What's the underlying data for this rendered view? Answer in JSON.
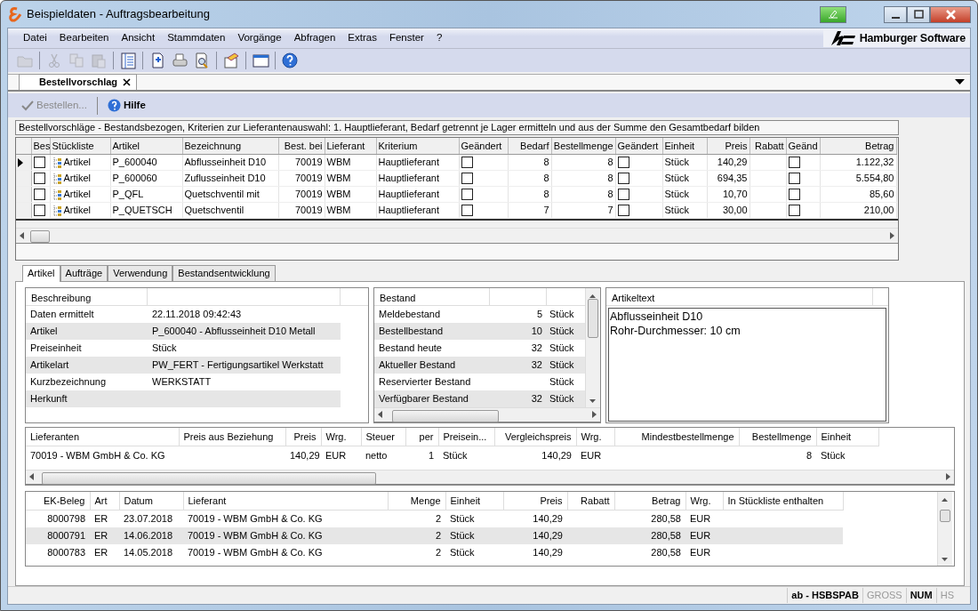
{
  "window": {
    "title": "Beispieldaten - Auftragsbearbeitung"
  },
  "menu": [
    "Datei",
    "Bearbeiten",
    "Ansicht",
    "Stammdaten",
    "Vorgänge",
    "Abfragen",
    "Extras",
    "Fenster",
    "?"
  ],
  "logo": {
    "text": "Hamburger Software"
  },
  "toolbar": [
    {
      "kind": "folder",
      "disabled": true
    },
    {
      "kind": "sep"
    },
    {
      "kind": "cut",
      "disabled": true
    },
    {
      "kind": "copy",
      "disabled": true
    },
    {
      "kind": "paste",
      "disabled": true
    },
    {
      "kind": "sep"
    },
    {
      "kind": "list",
      "disabled": false
    },
    {
      "kind": "sep"
    },
    {
      "kind": "new",
      "disabled": false
    },
    {
      "kind": "print",
      "disabled": false
    },
    {
      "kind": "preview",
      "disabled": false
    },
    {
      "kind": "sep"
    },
    {
      "kind": "settings",
      "disabled": false
    },
    {
      "kind": "sep"
    },
    {
      "kind": "window",
      "disabled": false
    },
    {
      "kind": "sep"
    },
    {
      "kind": "help",
      "disabled": false
    }
  ],
  "doc_tabs": [
    {
      "label": "Bestellvorschlag",
      "selected": true
    }
  ],
  "actions": [
    {
      "kind": "check",
      "label": "Bestellen...",
      "disabled": true
    },
    {
      "kind": "help",
      "label": "Hilfe",
      "disabled": false
    }
  ],
  "info_line": "Bestellvorschläge - Bestandsbezogen, Kriterien zur Lieferantenauswahl: 1. Hauptlieferant, Bedarf getrennt je Lager ermitteln und aus der Summe den Gesamtbedarf bilden",
  "order_grid": {
    "columns": [
      {
        "label": "Bes",
        "kind": "check"
      },
      {
        "label": "Stückliste",
        "kind": "bom"
      },
      {
        "label": "Artikel",
        "kind": "text"
      },
      {
        "label": "Bezeichnung",
        "kind": "text"
      },
      {
        "label": "Best. bei",
        "kind": "num"
      },
      {
        "label": "Lieferant",
        "kind": "text"
      },
      {
        "label": "Kriterium",
        "kind": "text"
      },
      {
        "label": "Geändert",
        "kind": "check"
      },
      {
        "label": "Bedarf",
        "kind": "num"
      },
      {
        "label": "Bestellmenge",
        "kind": "num"
      },
      {
        "label": "Geändert",
        "kind": "check"
      },
      {
        "label": "Einheit",
        "kind": "text"
      },
      {
        "label": "Preis",
        "kind": "num"
      },
      {
        "label": "Rabatt",
        "kind": "num"
      },
      {
        "label": "Geänd",
        "kind": "check"
      },
      {
        "label": "Betrag",
        "kind": "num"
      }
    ],
    "rows": [
      {
        "current": true,
        "cells": [
          false,
          "Artikel",
          "P_600040",
          "Abflusseinheit D10",
          "70019",
          "WBM",
          "Hauptlieferant",
          false,
          "8",
          "8",
          false,
          "Stück",
          "140,29",
          null,
          false,
          "1.122,32"
        ]
      },
      {
        "current": false,
        "cells": [
          false,
          "Artikel",
          "P_600060",
          "Zuflusseinheit D10",
          "70019",
          "WBM",
          "Hauptlieferant",
          false,
          "8",
          "8",
          false,
          "Stück",
          "694,35",
          null,
          false,
          "5.554,80"
        ]
      },
      {
        "current": false,
        "cells": [
          false,
          "Artikel",
          "P_QFL",
          "Quetschventil mit",
          "70019",
          "WBM",
          "Hauptlieferant",
          false,
          "8",
          "8",
          false,
          "Stück",
          "10,70",
          null,
          false,
          "85,60"
        ]
      },
      {
        "current": false,
        "cells": [
          false,
          "Artikel",
          "P_QUETSCH",
          "Quetschventil",
          "70019",
          "WBM",
          "Hauptlieferant",
          false,
          "7",
          "7",
          false,
          "Stück",
          "30,00",
          null,
          false,
          "210,00"
        ]
      }
    ]
  },
  "detail_tabs": [
    {
      "label": "Artikel",
      "selected": true
    },
    {
      "label": "Aufträge",
      "selected": false
    },
    {
      "label": "Verwendung",
      "selected": false
    },
    {
      "label": "Bestandsentwicklung",
      "selected": false
    }
  ],
  "beschreibung": {
    "header": "Beschreibung",
    "rows": [
      {
        "label": "Daten ermittelt",
        "value": "22.11.2018  09:42:43"
      },
      {
        "label": "Artikel",
        "value": "P_600040 - Abflusseinheit D10 Metall"
      },
      {
        "label": "Preiseinheit",
        "value": "Stück"
      },
      {
        "label": "Artikelart",
        "value": "PW_FERT - Fertigungsartikel Werkstatt"
      },
      {
        "label": "Kurzbezeichnung",
        "value": "WERKSTATT"
      },
      {
        "label": "Herkunft",
        "value": null
      }
    ]
  },
  "bestand": {
    "header": "Bestand",
    "rows": [
      {
        "label": "Meldebestand",
        "amount": "5",
        "unit": "Stück"
      },
      {
        "label": "Bestellbestand",
        "amount": "10",
        "unit": "Stück"
      },
      {
        "label": "Bestand heute",
        "amount": "32",
        "unit": "Stück"
      },
      {
        "label": "Aktueller Bestand",
        "amount": "32",
        "unit": "Stück"
      },
      {
        "label": "Reservierter Bestand",
        "amount": null,
        "unit": "Stück"
      },
      {
        "label": "Verfügbarer Bestand",
        "amount": "32",
        "unit": "Stück"
      }
    ]
  },
  "artikeltext": {
    "header": "Artikeltext",
    "lines": [
      "Abflusseinheit D10",
      "Rohr-Durchmesser: 10 cm"
    ]
  },
  "lieferanten": {
    "columns": [
      {
        "label": "Lieferanten",
        "kind": "text"
      },
      {
        "label": "Preis aus Beziehung",
        "kind": "text"
      },
      {
        "label": "Preis",
        "kind": "num"
      },
      {
        "label": "Wrg.",
        "kind": "text"
      },
      {
        "label": "Steuer",
        "kind": "text"
      },
      {
        "label": "per",
        "kind": "num"
      },
      {
        "label": "Preisein...",
        "kind": "text"
      },
      {
        "label": "Vergleichspreis",
        "kind": "num"
      },
      {
        "label": "Wrg.",
        "kind": "text"
      },
      {
        "label": "Mindestbestellmenge",
        "kind": "num"
      },
      {
        "label": "Bestellmenge",
        "kind": "num"
      },
      {
        "label": "Einheit",
        "kind": "text"
      }
    ],
    "rows": [
      [
        "70019 - WBM GmbH & Co. KG",
        null,
        "140,29",
        "EUR",
        "netto",
        "1",
        "Stück",
        "140,29",
        "EUR",
        null,
        "8",
        "Stück"
      ]
    ]
  },
  "ek_belege": {
    "columns": [
      {
        "label": "EK-Beleg",
        "kind": "num"
      },
      {
        "label": "Art",
        "kind": "text"
      },
      {
        "label": "Datum",
        "kind": "text"
      },
      {
        "label": "Lieferant",
        "kind": "text"
      },
      {
        "label": "Menge",
        "kind": "num"
      },
      {
        "label": "Einheit",
        "kind": "text"
      },
      {
        "label": "Preis",
        "kind": "num"
      },
      {
        "label": "Rabatt",
        "kind": "num"
      },
      {
        "label": "Betrag",
        "kind": "num"
      },
      {
        "label": "Wrg.",
        "kind": "text"
      },
      {
        "label": "In Stückliste enthalten",
        "kind": "text"
      }
    ],
    "rows": [
      [
        "8000798",
        "ER",
        "23.07.2018",
        "70019 - WBM GmbH & Co. KG",
        "2",
        "Stück",
        "140,29",
        null,
        "280,58",
        "EUR",
        null
      ],
      [
        "8000791",
        "ER",
        "14.06.2018",
        "70019 - WBM GmbH & Co. KG",
        "2",
        "Stück",
        "140,29",
        null,
        "280,58",
        "EUR",
        null
      ],
      [
        "8000783",
        "ER",
        "14.05.2018",
        "70019 - WBM GmbH & Co. KG",
        "2",
        "Stück",
        "140,29",
        null,
        "280,58",
        "EUR",
        null
      ]
    ]
  },
  "status_bar": [
    {
      "text": "ab - HSBSPAB",
      "disabled": false
    },
    {
      "text": "GROSS",
      "disabled": true
    },
    {
      "text": "NUM",
      "disabled": false
    },
    {
      "text": "HS",
      "disabled": true
    }
  ]
}
